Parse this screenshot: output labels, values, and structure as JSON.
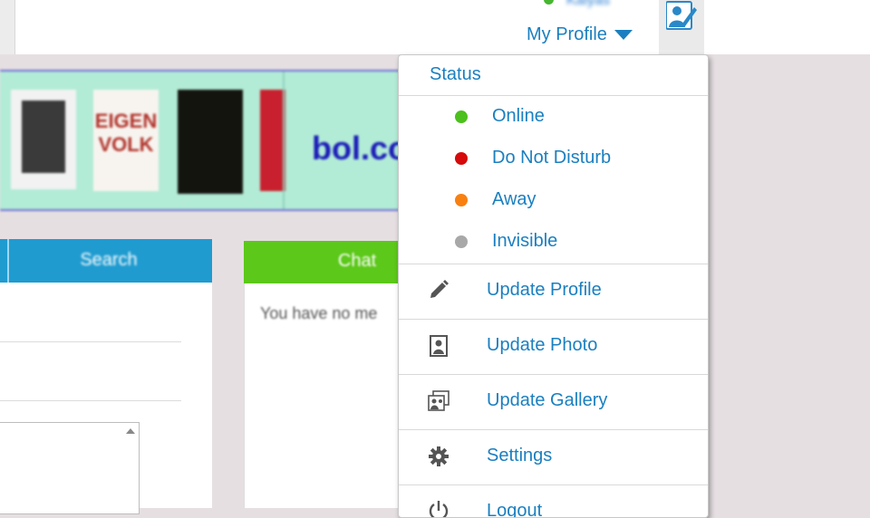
{
  "header": {
    "username": "Kalyas",
    "profile_menu_label": "My Profile",
    "online_color": "#46b62f"
  },
  "banner": {
    "book_title": "EIGEN VOLK",
    "brand": "bol.co"
  },
  "left_panel": {
    "tab_label": "Search"
  },
  "chat_panel": {
    "tab_label": "Chat",
    "message": "You have no me"
  },
  "profile_menu": {
    "status_header": "Status",
    "statuses": [
      {
        "label": "Online",
        "color": "#4cc01c"
      },
      {
        "label": "Do Not Disturb",
        "color": "#d60a0a"
      },
      {
        "label": "Away",
        "color": "#f88010"
      },
      {
        "label": "Invisible",
        "color": "#a8a8a8"
      }
    ],
    "actions": [
      {
        "label": "Update Profile",
        "icon": "pencil-icon"
      },
      {
        "label": "Update Photo",
        "icon": "photo-icon"
      },
      {
        "label": "Update Gallery",
        "icon": "gallery-icon"
      },
      {
        "label": "Settings",
        "icon": "gear-icon"
      },
      {
        "label": "Logout",
        "icon": "power-icon"
      }
    ]
  }
}
